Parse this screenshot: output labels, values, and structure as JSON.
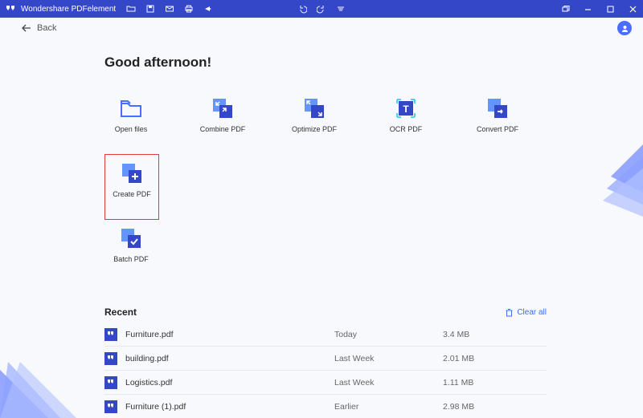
{
  "titlebar": {
    "app_name": "Wondershare PDFelement"
  },
  "back": {
    "label": "Back"
  },
  "greeting": "Good afternoon!",
  "tiles": [
    {
      "label": "Open files",
      "icon": "folder"
    },
    {
      "label": "Combine PDF",
      "icon": "combine"
    },
    {
      "label": "Optimize PDF",
      "icon": "optimize"
    },
    {
      "label": "OCR PDF",
      "icon": "ocr"
    },
    {
      "label": "Convert PDF",
      "icon": "convert"
    },
    {
      "label": "Create PDF",
      "icon": "create"
    },
    {
      "label": "Batch PDF",
      "icon": "batch"
    }
  ],
  "highlight_index": 5,
  "recent": {
    "heading": "Recent",
    "clear_label": "Clear all",
    "items": [
      {
        "name": "Furniture.pdf",
        "date": "Today",
        "size": "3.4 MB"
      },
      {
        "name": "building.pdf",
        "date": "Last Week",
        "size": "2.01 MB"
      },
      {
        "name": "Logistics.pdf",
        "date": "Last Week",
        "size": "1.11 MB"
      },
      {
        "name": "Furniture (1).pdf",
        "date": "Earlier",
        "size": "2.98 MB"
      }
    ]
  }
}
